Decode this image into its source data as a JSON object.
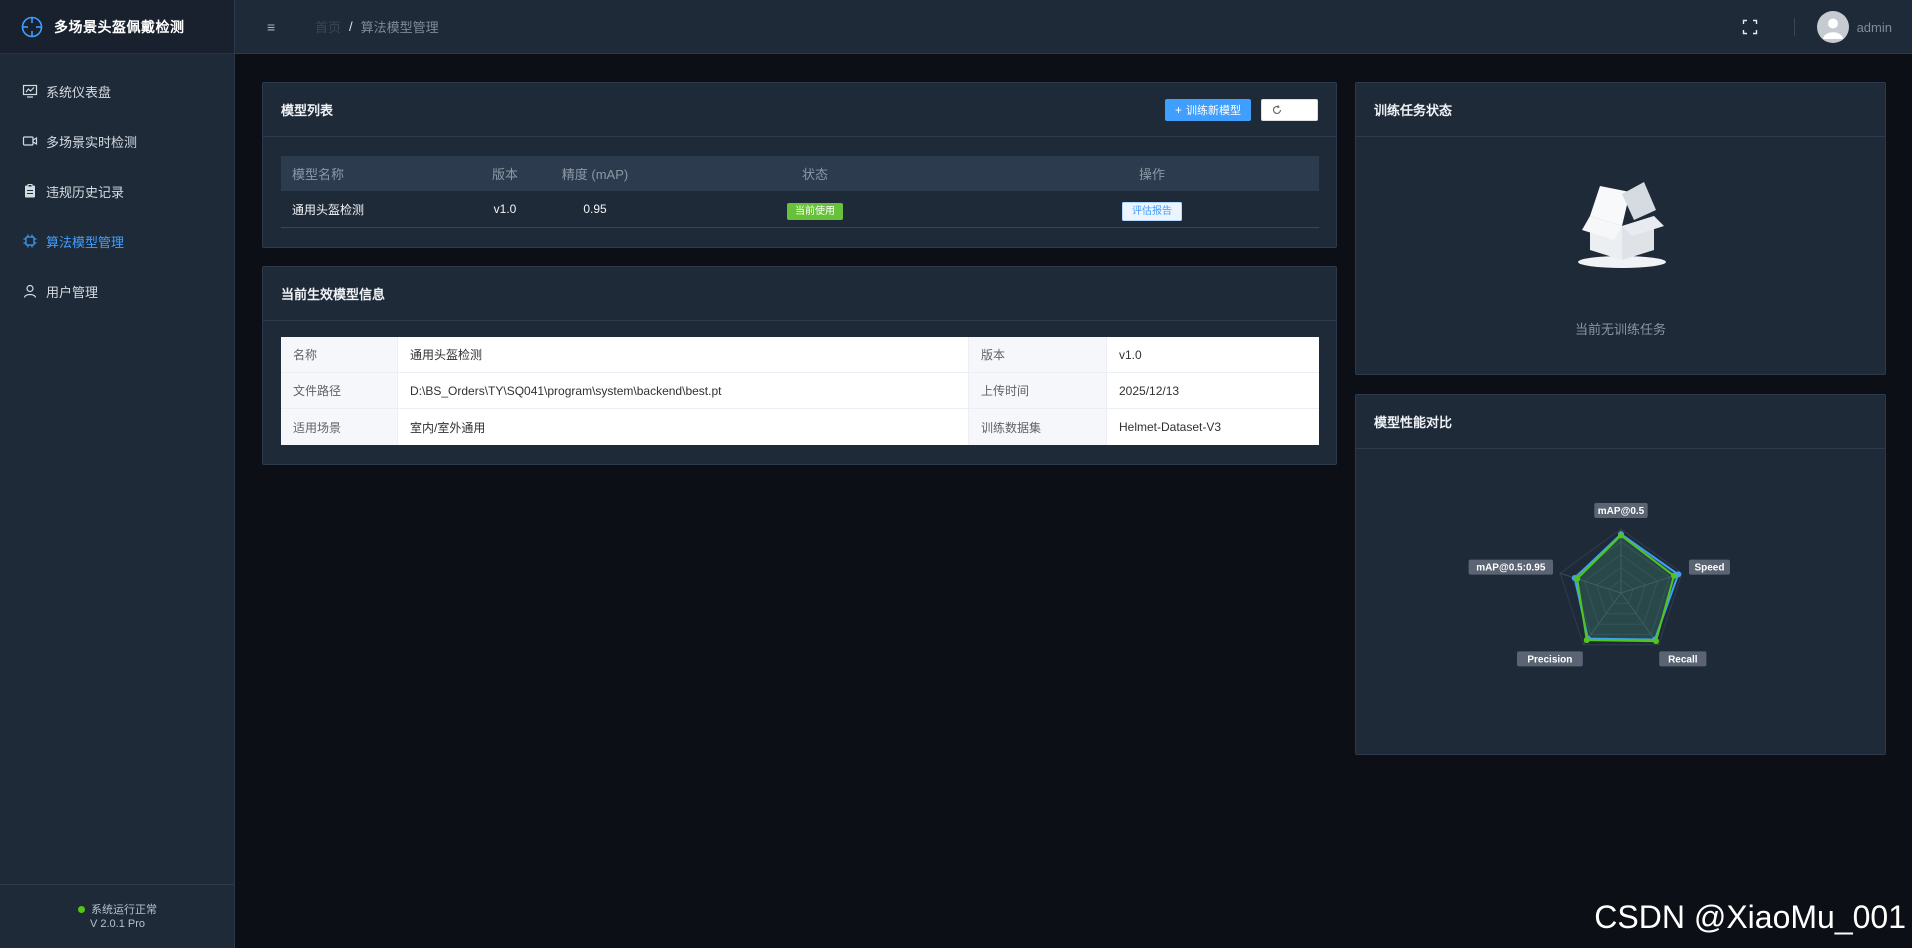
{
  "app": {
    "title": "多场景头盔佩戴检测"
  },
  "sidebar": {
    "items": [
      {
        "label": "系统仪表盘",
        "icon": "dashboard-icon",
        "active": false
      },
      {
        "label": "多场景实时检测",
        "icon": "camera-icon",
        "active": false
      },
      {
        "label": "违规历史记录",
        "icon": "clipboard-icon",
        "active": false
      },
      {
        "label": "算法模型管理",
        "icon": "chip-icon",
        "active": true
      },
      {
        "label": "用户管理",
        "icon": "user-icon",
        "active": false
      }
    ],
    "footer": {
      "status": "系统运行正常",
      "version": "V 2.0.1 Pro"
    }
  },
  "header": {
    "breadcrumb": {
      "home": "首页",
      "separator": "/",
      "current": "算法模型管理"
    },
    "user": {
      "name": "admin"
    }
  },
  "model_list": {
    "title": "模型列表",
    "train_button": "训练新模型",
    "columns": [
      "模型名称",
      "版本",
      "精度 (mAP)",
      "状态",
      "操作"
    ],
    "rows": [
      {
        "name": "通用头盔检测",
        "version": "v1.0",
        "map": "0.95",
        "status": "当前使用",
        "action": "评估报告"
      }
    ]
  },
  "current_model": {
    "title": "当前生效模型信息",
    "rows": [
      [
        {
          "label": "名称",
          "value": "通用头盔检测"
        },
        {
          "label": "版本",
          "value": "v1.0"
        }
      ],
      [
        {
          "label": "文件路径",
          "value": "D:\\BS_Orders\\TY\\SQ041\\program\\system\\backend\\best.pt"
        },
        {
          "label": "上传时间",
          "value": "2025/12/13"
        }
      ],
      [
        {
          "label": "适用场景",
          "value": "室内/室外通用"
        },
        {
          "label": "训练数据集",
          "value": "Helmet-Dataset-V3"
        }
      ]
    ]
  },
  "training": {
    "title": "训练任务状态",
    "empty_text": "当前无训练任务"
  },
  "comparison": {
    "title": "模型性能对比",
    "chart_data": {
      "type": "radar",
      "indicators": [
        "mAP@0.5",
        "Speed",
        "Recall",
        "Precision",
        "mAP@0.5:0.95"
      ],
      "max": 1.0,
      "series": [
        {
          "values": [
            0.92,
            0.94,
            0.9,
            0.88,
            0.76
          ],
          "color": "#409eff"
        },
        {
          "values": [
            0.9,
            0.87,
            0.93,
            0.91,
            0.72
          ],
          "color": "#52c41a"
        }
      ]
    }
  },
  "colors": {
    "accent": "#409eff",
    "success": "#67c23a",
    "sidebar_bg": "#1f2a38",
    "page_bg": "#0c0f16"
  },
  "watermark": "CSDN @XiaoMu_001"
}
